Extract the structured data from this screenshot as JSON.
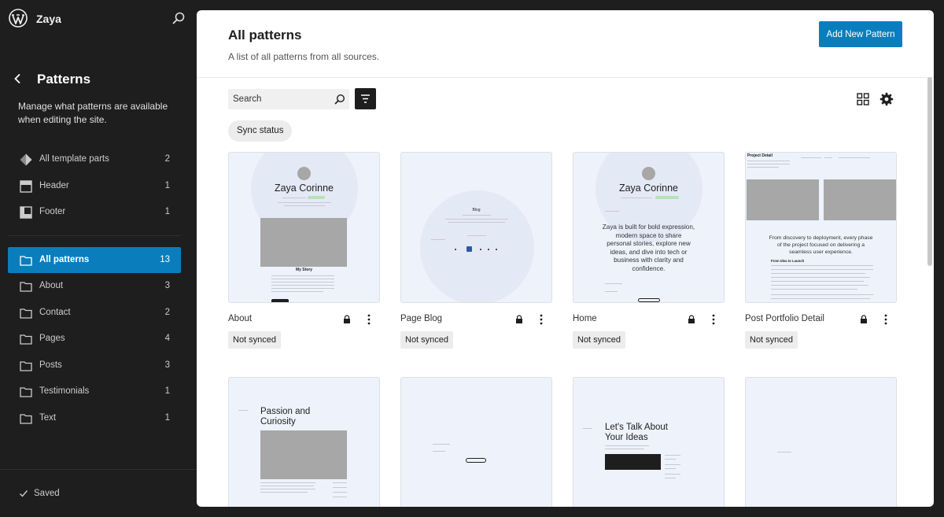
{
  "site": {
    "name": "Zaya"
  },
  "sidebar": {
    "title": "Patterns",
    "description": "Manage what patterns are available when editing the site.",
    "template_parts": [
      {
        "label": "All template parts",
        "count": "2",
        "icon": "template-parts-icon"
      },
      {
        "label": "Header",
        "count": "1",
        "icon": "header-icon"
      },
      {
        "label": "Footer",
        "count": "1",
        "icon": "footer-icon"
      }
    ],
    "categories": [
      {
        "label": "All patterns",
        "count": "13",
        "active": true
      },
      {
        "label": "About",
        "count": "3"
      },
      {
        "label": "Contact",
        "count": "2"
      },
      {
        "label": "Pages",
        "count": "4"
      },
      {
        "label": "Posts",
        "count": "3"
      },
      {
        "label": "Testimonials",
        "count": "1"
      },
      {
        "label": "Text",
        "count": "1"
      }
    ],
    "status": "Saved"
  },
  "main": {
    "title": "All patterns",
    "subtitle": "A list of all patterns from all sources.",
    "add_button": "Add New Pattern",
    "search_placeholder": "Search",
    "sync_filter": "Sync status",
    "patterns": [
      {
        "title": "About",
        "badge": "Not synced",
        "locked": true,
        "preview": {
          "name": "Zaya Corinne",
          "heading": "My Story"
        }
      },
      {
        "title": "Page Blog",
        "badge": "Not synced",
        "locked": true,
        "preview": {
          "heading": "Blog"
        }
      },
      {
        "title": "Home",
        "badge": "Not synced",
        "locked": true,
        "preview": {
          "name": "Zaya Corinne",
          "intro_1": "Zaya is built for bold expression,",
          "intro_2": "modern space to share",
          "intro_3": "personal stories, explore new",
          "intro_4": "ideas, and dive into tech or",
          "intro_5": "business with clarity and",
          "intro_6": "confidence."
        }
      },
      {
        "title": "Post Portfolio Detail",
        "badge": "Not synced",
        "locked": true,
        "preview": {
          "heading": "Project Detail",
          "tagline_1": "From discovery to deployment, every phase",
          "tagline_2": "of the project focused on delivering a",
          "tagline_3": "seamless user experience.",
          "section": "From Idea to Launch"
        }
      },
      {
        "title": "",
        "preview": {
          "heading_1": "Passion and",
          "heading_2": "Curiosity"
        }
      },
      {
        "title": "",
        "preview": {}
      },
      {
        "title": "",
        "preview": {
          "heading_1": "Let's Talk About",
          "heading_2": "Your Ideas"
        }
      },
      {
        "title": "",
        "preview": {}
      }
    ]
  },
  "colors": {
    "accent": "#0a7ebd",
    "sidebar_bg": "#1e1e1e",
    "thumb_bg": "#eef2fb"
  }
}
